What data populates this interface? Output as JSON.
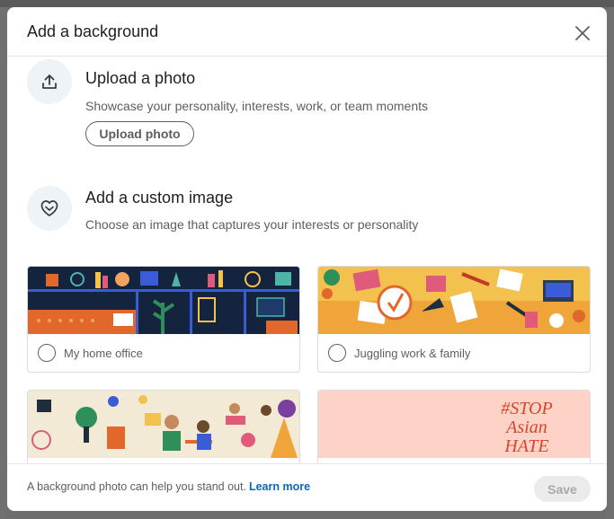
{
  "modal": {
    "title": "Add a background",
    "close_icon": "close-icon"
  },
  "upload_section": {
    "icon": "upload-icon",
    "title": "Upload a photo",
    "description": "Showcase your personality, interests, work, or team moments",
    "button_label": "Upload photo"
  },
  "custom_section": {
    "icon": "heart-shield-icon",
    "title": "Add a custom image",
    "description": "Choose an image that captures your interests or personality"
  },
  "images": [
    {
      "label": "My home office",
      "selected": false,
      "theme_color": "#1b2b4a"
    },
    {
      "label": "Juggling work & family",
      "selected": false,
      "theme_color": "#f2c14e"
    },
    {
      "label": "",
      "selected": false,
      "theme_color": "#f3ead6"
    },
    {
      "label": "",
      "selected": false,
      "theme_color": "#fcd3c6",
      "overlay_text": [
        "#STOP",
        "Asian",
        "HATE"
      ]
    }
  ],
  "footer": {
    "text": "A background photo can help you stand out.",
    "link_label": "Learn more",
    "save_label": "Save"
  },
  "colors": {
    "accent": "#0a66c2",
    "icon_bg": "#eef3f8"
  }
}
